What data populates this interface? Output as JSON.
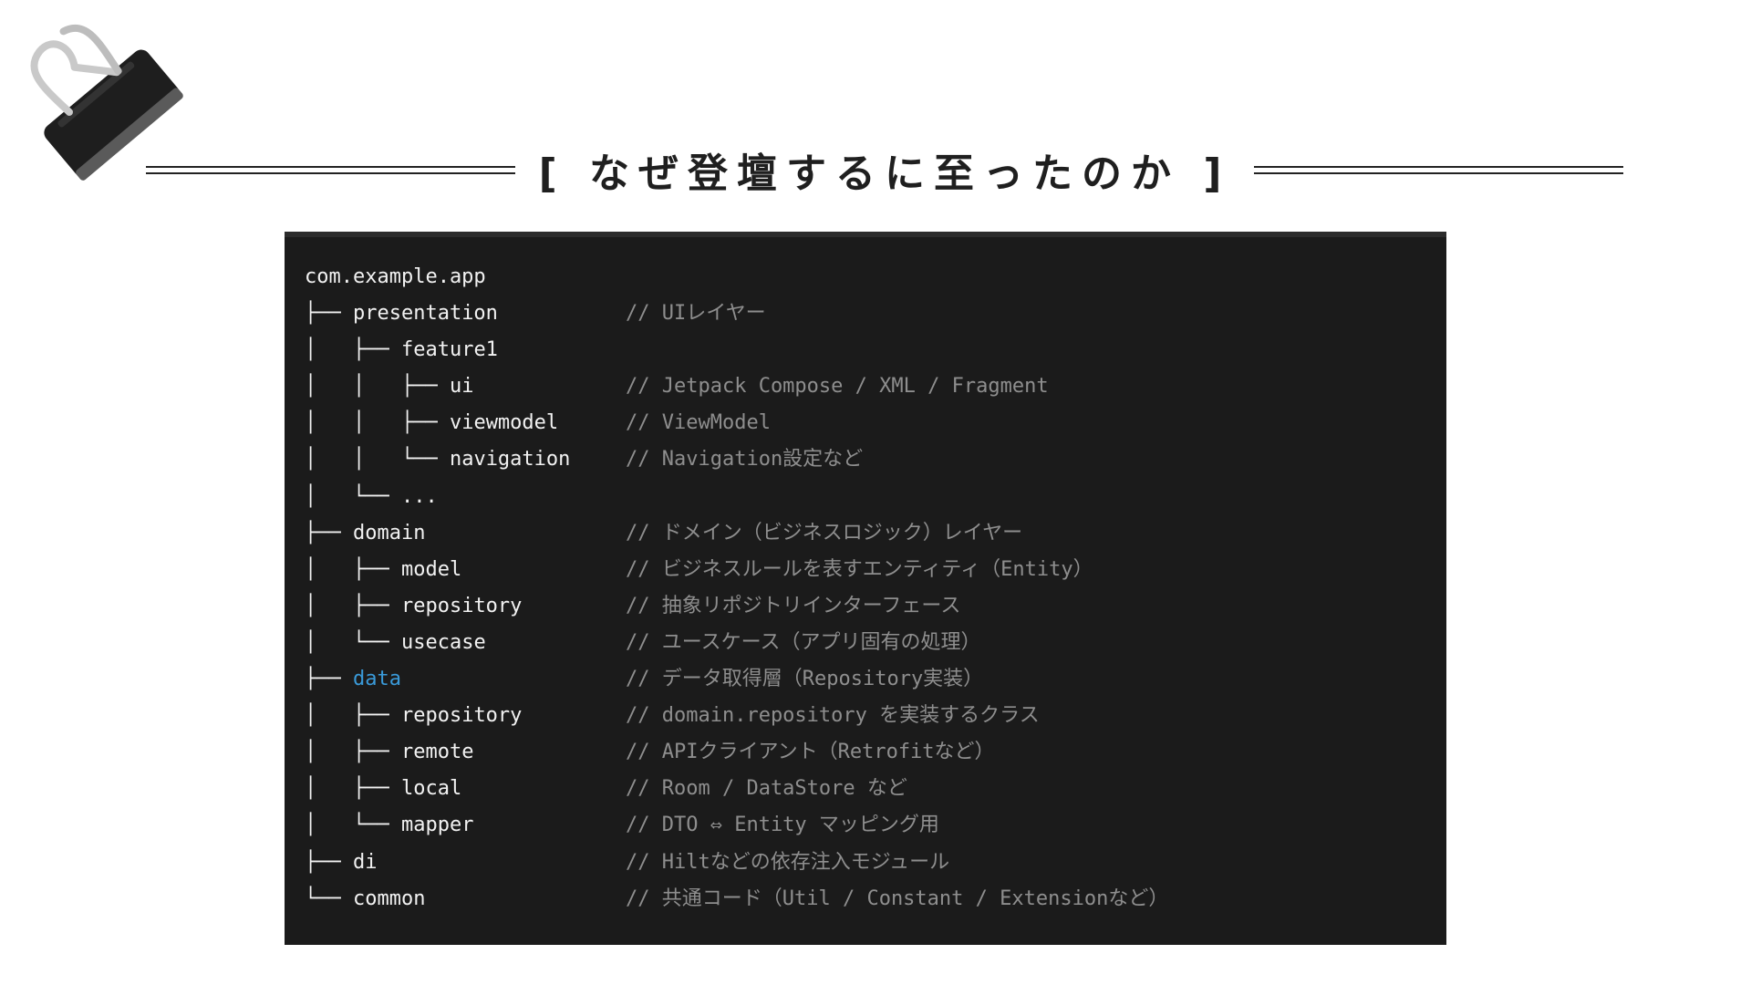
{
  "title": "[ なぜ登壇するに至ったのか ]",
  "colors": {
    "background": "#ffffff",
    "code_background": "#1b1b1b",
    "code_text": "#f2f2f2",
    "comment_text": "#8e8e8e",
    "highlight": "#3a9ad9"
  },
  "icons": {
    "binder_clip": "binder-clip-icon"
  },
  "code": {
    "lines": [
      {
        "tree": "",
        "name": "com.example.app",
        "comment": ""
      },
      {
        "tree": "├── ",
        "name": "presentation",
        "comment": "// UIレイヤー"
      },
      {
        "tree": "│   ├── ",
        "name": "feature1",
        "comment": ""
      },
      {
        "tree": "│   │   ├── ",
        "name": "ui",
        "comment": "// Jetpack Compose / XML / Fragment"
      },
      {
        "tree": "│   │   ├── ",
        "name": "viewmodel",
        "comment": "// ViewModel"
      },
      {
        "tree": "│   │   └── ",
        "name": "navigation",
        "comment": "// Navigation設定など"
      },
      {
        "tree": "│   └── ",
        "name": "...",
        "comment": ""
      },
      {
        "tree": "├── ",
        "name": "domain",
        "comment": "// ドメイン（ビジネスロジック）レイヤー"
      },
      {
        "tree": "│   ├── ",
        "name": "model",
        "comment": "// ビジネスルールを表すエンティティ（Entity）"
      },
      {
        "tree": "│   ├── ",
        "name": "repository",
        "comment": "// 抽象リポジトリインターフェース"
      },
      {
        "tree": "│   └── ",
        "name": "usecase",
        "comment": "// ユースケース（アプリ固有の処理）"
      },
      {
        "tree": "├── ",
        "name": "data",
        "comment": "// データ取得層（Repository実装）",
        "highlight": true
      },
      {
        "tree": "│   ├── ",
        "name": "repository",
        "comment": "// domain.repository を実装するクラス"
      },
      {
        "tree": "│   ├── ",
        "name": "remote",
        "comment": "// APIクライアント（Retrofitなど）"
      },
      {
        "tree": "│   ├── ",
        "name": "local",
        "comment": "// Room / DataStore など"
      },
      {
        "tree": "│   └── ",
        "name": "mapper",
        "comment": "// DTO ⇔ Entity マッピング用"
      },
      {
        "tree": "├── ",
        "name": "di",
        "comment": "// Hiltなどの依存注入モジュール"
      },
      {
        "tree": "└── ",
        "name": "common",
        "comment": "// 共通コード（Util / Constant / Extensionなど）"
      }
    ]
  }
}
